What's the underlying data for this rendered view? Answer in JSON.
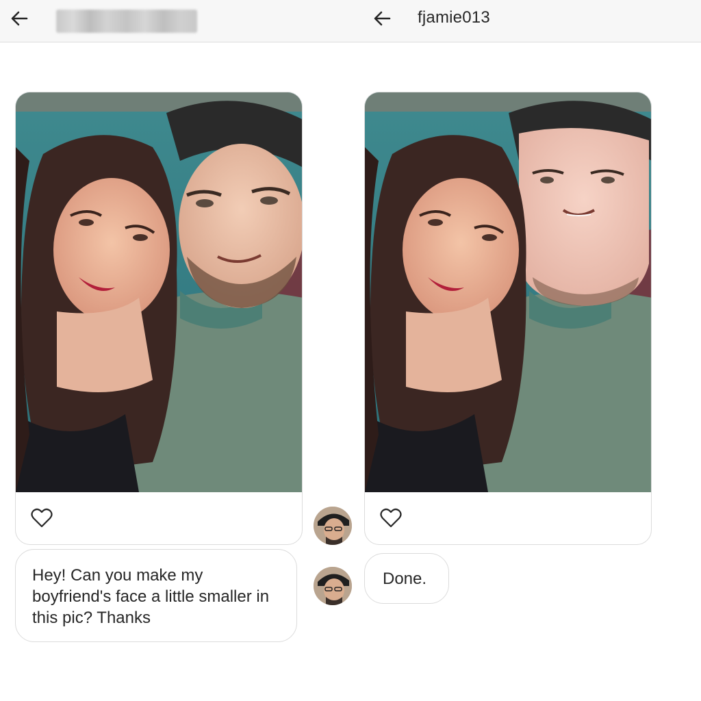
{
  "header": {
    "left_back_icon": "arrow-left-icon",
    "right_back_icon": "arrow-left-icon",
    "right_username": "fjamie013"
  },
  "conversation": {
    "request_message": "Hey! Can you make my boyfriend's face a little smaller in this pic? Thanks",
    "reply_message": "Done.",
    "original_photo_like_icon": "heart-icon",
    "edited_photo_like_icon": "heart-icon"
  },
  "colors": {
    "header_bg": "#f7f7f7",
    "border": "#dbdbdb",
    "text": "#262626"
  }
}
